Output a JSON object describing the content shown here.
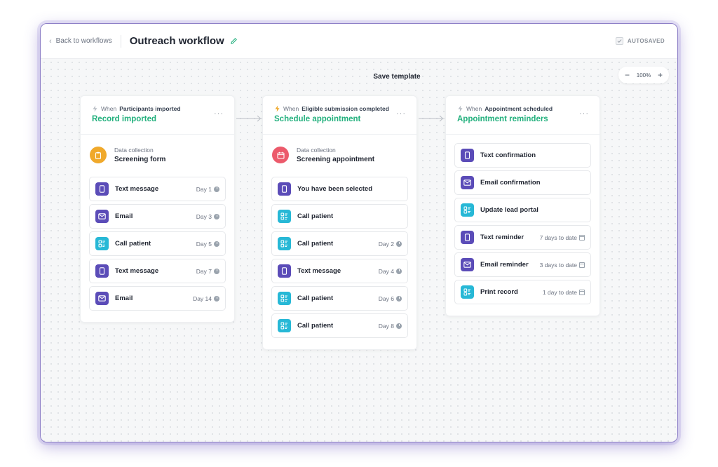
{
  "header": {
    "back_label": "Back to workflows",
    "title": "Outreach workflow",
    "autosaved": "AUTOSAVED"
  },
  "canvas": {
    "save_template": "Save template",
    "zoom": {
      "level": "100%",
      "minus": "−",
      "plus": "+"
    }
  },
  "columns": [
    {
      "trigger_prefix": "When",
      "trigger_event": "Participants imported",
      "title": "Record imported",
      "menu": "···",
      "data_collection": {
        "label": "Data collection",
        "name": "Screening form",
        "color": "#f0a92b",
        "icon": "clipboard-icon"
      },
      "steps": [
        {
          "label": "Text message",
          "day": "Day 1",
          "icon": "phone-icon",
          "color": "purple"
        },
        {
          "label": "Email",
          "day": "Day 3",
          "icon": "mail-icon",
          "color": "purple"
        },
        {
          "label": "Call patient",
          "day": "Day 5",
          "icon": "call-list-icon",
          "color": "teal"
        },
        {
          "label": "Text message",
          "day": "Day 7",
          "icon": "phone-icon",
          "color": "purple"
        },
        {
          "label": "Email",
          "day": "Day 14",
          "icon": "mail-icon",
          "color": "purple"
        }
      ]
    },
    {
      "trigger_prefix": "When",
      "trigger_event": "Eligible submission completed",
      "title": "Schedule appointment",
      "menu": "···",
      "data_collection": {
        "label": "Data collection",
        "name": "Screening appointment",
        "color": "#ec5a6b",
        "icon": "calendar-icon"
      },
      "steps": [
        {
          "label": "You have been selected",
          "day": "",
          "icon": "phone-icon",
          "color": "purple"
        },
        {
          "label": "Call patient",
          "day": "",
          "icon": "call-list-icon",
          "color": "teal"
        },
        {
          "label": "Call patient",
          "day": "Day 2",
          "icon": "call-list-icon",
          "color": "teal"
        },
        {
          "label": "Text message",
          "day": "Day 4",
          "icon": "phone-icon",
          "color": "purple"
        },
        {
          "label": "Call patient",
          "day": "Day 6",
          "icon": "call-list-icon",
          "color": "teal"
        },
        {
          "label": "Call patient",
          "day": "Day 8",
          "icon": "call-list-icon",
          "color": "teal"
        }
      ]
    },
    {
      "trigger_prefix": "When",
      "trigger_event": "Appointment scheduled",
      "title": "Appointment reminders",
      "menu": "···",
      "steps": [
        {
          "label": "Text confirmation",
          "day": "",
          "icon": "phone-icon",
          "color": "purple"
        },
        {
          "label": "Email confirmation",
          "day": "",
          "icon": "mail-icon",
          "color": "purple"
        },
        {
          "label": "Update lead portal",
          "day": "",
          "icon": "call-list-icon",
          "color": "teal"
        },
        {
          "label": "Text reminder",
          "day": "7 days to date",
          "icon": "phone-icon",
          "color": "purple",
          "badge": "calendar"
        },
        {
          "label": "Email reminder",
          "day": "3 days to date",
          "icon": "mail-icon",
          "color": "purple",
          "badge": "calendar"
        },
        {
          "label": "Print record",
          "day": "1 day to date",
          "icon": "call-list-icon",
          "color": "teal",
          "badge": "calendar"
        }
      ]
    }
  ],
  "colors": {
    "accent_green": "#22b07d",
    "purple": "#5b4cb8",
    "teal": "#27b8d6"
  }
}
